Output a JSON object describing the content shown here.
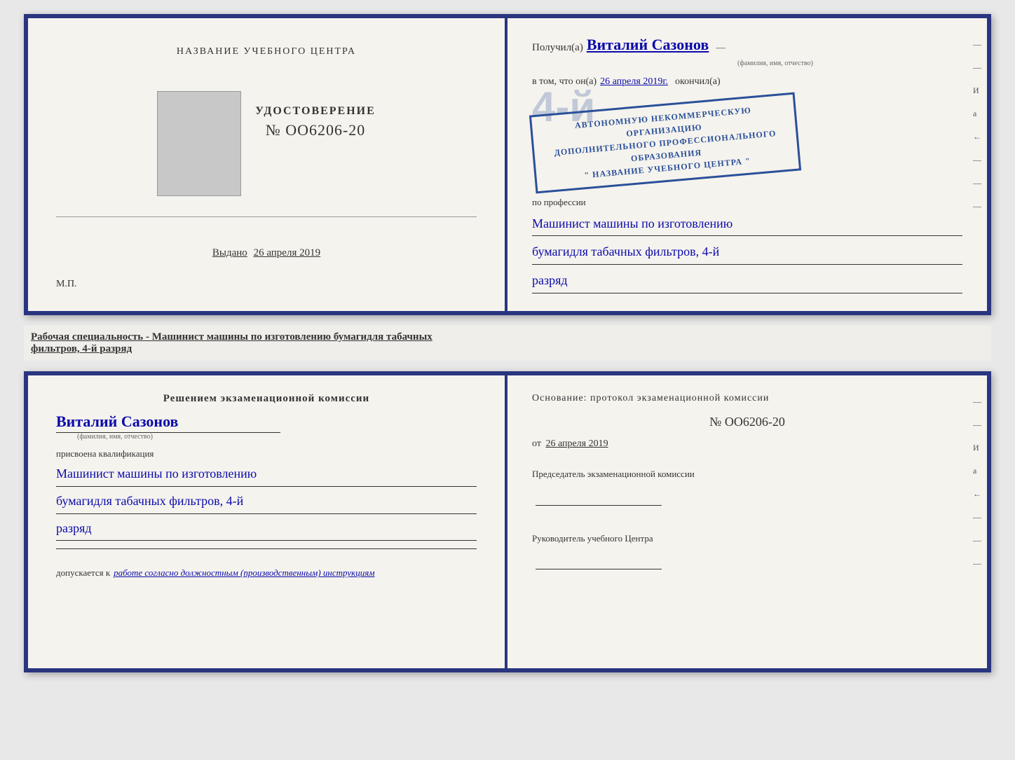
{
  "topCert": {
    "left": {
      "title": "НАЗВАНИЕ УЧЕБНОГО ЦЕНТРА",
      "udostTitle": "УДОСТОВЕРЕНИЕ",
      "udostNumber": "№ OO6206-20",
      "issuedLabel": "Выдано",
      "issuedDate": "26 апреля 2019",
      "mp": "М.П."
    },
    "right": {
      "receivedLabel": "Получил(а)",
      "fio": "Виталий Сазонов",
      "fioSubLabel": "(фамилия, имя, отчество)",
      "vTomLabel": "в том, что он(а)",
      "date": "26 апреля 2019г.",
      "okonchilLabel": "окончил(а)",
      "stampLine1": "АВТОНОМНУЮ НЕКОММЕРЧЕСКУЮ ОРГАНИЗАЦИЮ",
      "stampLine2": "ДОПОЛНИТЕЛЬНОГО ПРОФЕССИОНАЛЬНОГО ОБРАЗОВАНИЯ",
      "stampLine3": "\" НАЗВАНИЕ УЧЕБНОГО ЦЕНТРА \"",
      "poLabel": "по профессии",
      "profession1": "Машинист машины по изготовлению",
      "profession2": "бумагидля табачных фильтров, 4-й",
      "profession3": "разряд",
      "sideMarks": [
        "-",
        "-",
        "И",
        "а",
        "←",
        "-",
        "-",
        "-",
        "-",
        "-"
      ]
    }
  },
  "middleText": {
    "label": "Рабочая специальность - Машинист машины по изготовлению бумагидля табачных",
    "underlined": "фильтров, 4-й разряд"
  },
  "bottomCert": {
    "left": {
      "title": "Решением экзаменационной комиссии",
      "fio": "Виталий Сазонов",
      "fioSubLabel": "(фамилия, имя, отчество)",
      "prisvoenaLabel": "присвоена квалификация",
      "qual1": "Машинист машины по изготовлению",
      "qual2": "бумагидля табачных фильтров, 4-й",
      "qual3": "разряд",
      "dopuskaetsyaLabel": "допускается к",
      "dopuskaetsyaValue": "работе согласно должностным (производственным) инструкциям"
    },
    "right": {
      "osnovanie": "Основание: протокол экзаменационной комиссии",
      "number": "№ OO6206-20",
      "otLabel": "от",
      "date": "26 апреля 2019",
      "predsedatelLabel": "Председатель экзаменационной комиссии",
      "rukovoditelLabel": "Руководитель учебного Центра",
      "sideMarks": [
        "-",
        "-",
        "И",
        "а",
        "←",
        "-",
        "-",
        "-",
        "-",
        "-"
      ]
    }
  }
}
